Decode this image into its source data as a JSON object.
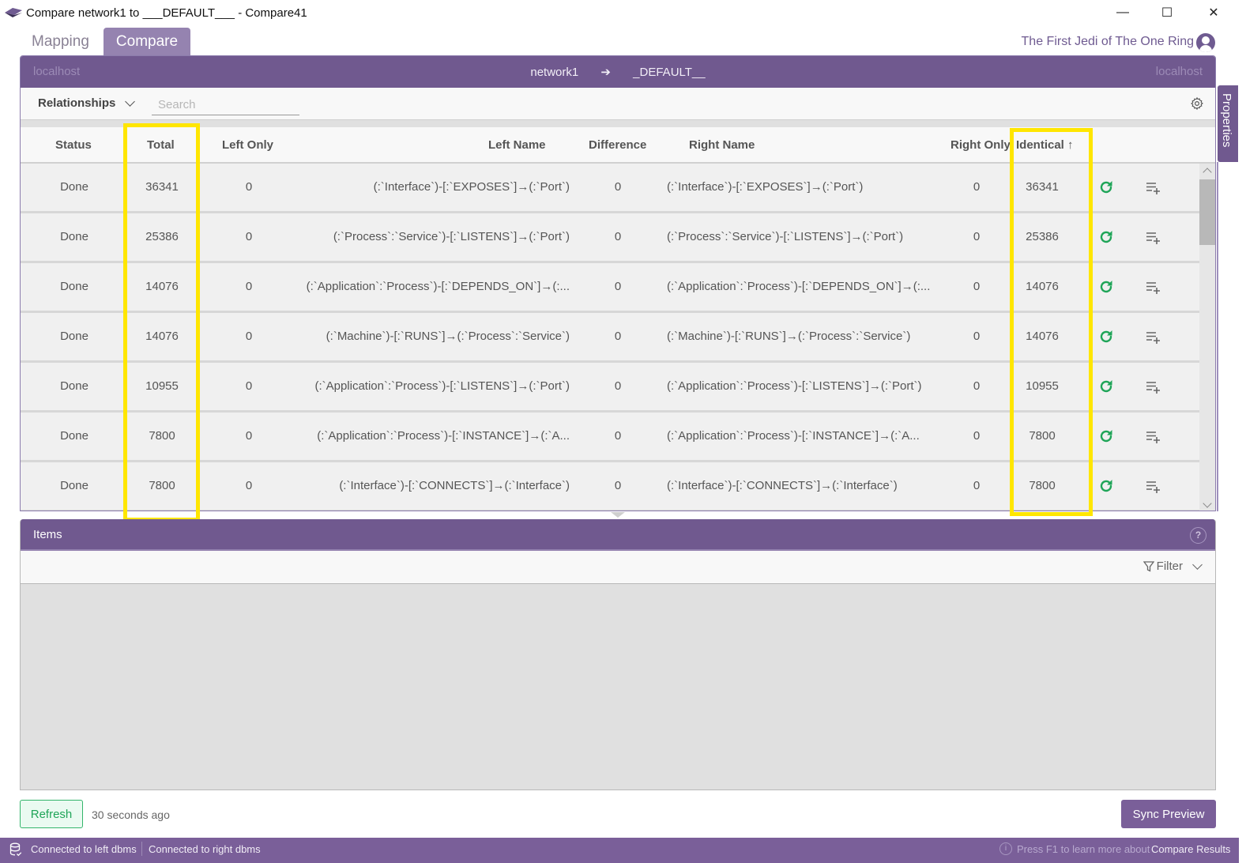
{
  "window": {
    "title": "Compare network1 to ___DEFAULT___ - Compare41",
    "minimize_glyph": "—",
    "maximize_glyph": "☐",
    "close_glyph": "✕"
  },
  "tabs": [
    {
      "label": "Mapping",
      "active": false
    },
    {
      "label": "Compare",
      "active": true
    }
  ],
  "user": {
    "name": "The First Jedi of The One Ring",
    "icon": "user-circle-icon"
  },
  "connection": {
    "left_host": "localhost",
    "right_host": "localhost",
    "left_db": "network1",
    "arrow": "➔",
    "right_db": "_DEFAULT__"
  },
  "toolbar": {
    "type_label": "Relationships",
    "search_placeholder": "Search",
    "search_value": "",
    "settings_icon": "gear-icon"
  },
  "table": {
    "columns": {
      "status": "Status",
      "total": "Total",
      "left_only": "Left Only",
      "left_name": "Left Name",
      "difference": "Difference",
      "right_name": "Right Name",
      "right_only": "Right Only",
      "identical": "Identical ↑"
    },
    "rows": [
      {
        "status": "Done",
        "total": "36341",
        "left_only": "0",
        "left_name": "(:`Interface`)-[:`EXPOSES`]→(:`Port`)",
        "difference": "0",
        "right_name": "(:`Interface`)-[:`EXPOSES`]→(:`Port`)",
        "right_only": "0",
        "identical": "36341"
      },
      {
        "status": "Done",
        "total": "25386",
        "left_only": "0",
        "left_name": "(:`Process`:`Service`)-[:`LISTENS`]→(:`Port`)",
        "difference": "0",
        "right_name": "(:`Process`:`Service`)-[:`LISTENS`]→(:`Port`)",
        "right_only": "0",
        "identical": "25386"
      },
      {
        "status": "Done",
        "total": "14076",
        "left_only": "0",
        "left_name": "(:`Application`:`Process`)-[:`DEPENDS_ON`]→(:...",
        "difference": "0",
        "right_name": "(:`Application`:`Process`)-[:`DEPENDS_ON`]→(:...",
        "right_only": "0",
        "identical": "14076"
      },
      {
        "status": "Done",
        "total": "14076",
        "left_only": "0",
        "left_name": "(:`Machine`)-[:`RUNS`]→(:`Process`:`Service`)",
        "difference": "0",
        "right_name": "(:`Machine`)-[:`RUNS`]→(:`Process`:`Service`)",
        "right_only": "0",
        "identical": "14076"
      },
      {
        "status": "Done",
        "total": "10955",
        "left_only": "0",
        "left_name": "(:`Application`:`Process`)-[:`LISTENS`]→(:`Port`)",
        "difference": "0",
        "right_name": "(:`Application`:`Process`)-[:`LISTENS`]→(:`Port`)",
        "right_only": "0",
        "identical": "10955"
      },
      {
        "status": "Done",
        "total": "7800",
        "left_only": "0",
        "left_name": "(:`Application`:`Process`)-[:`INSTANCE`]→(:`A...",
        "difference": "0",
        "right_name": "(:`Application`:`Process`)-[:`INSTANCE`]→(:`A...",
        "right_only": "0",
        "identical": "7800"
      },
      {
        "status": "Done",
        "total": "7800",
        "left_only": "0",
        "left_name": "(:`Interface`)-[:`CONNECTS`]→(:`Interface`)",
        "difference": "0",
        "right_name": "(:`Interface`)-[:`CONNECTS`]→(:`Interface`)",
        "right_only": "0",
        "identical": "7800"
      }
    ]
  },
  "side_panel": {
    "label": "Properties"
  },
  "items_panel": {
    "title": "Items",
    "help_glyph": "?",
    "filter_label": "Filter"
  },
  "footer": {
    "refresh_label": "Refresh",
    "refreshed_ago": "30 seconds ago",
    "sync_label": "Sync Preview"
  },
  "statusbar": {
    "left_status": "Connected to left dbms",
    "right_status": "Connected to right dbms",
    "info_glyph": "i",
    "hint": "Press  F1 to learn more about",
    "hint_topic": "Compare Results"
  },
  "colors": {
    "brand_purple": "#70598f",
    "tab_active": "#9583b0",
    "refresh_green": "#1fa558",
    "highlight_yellow": "#ffe600"
  }
}
